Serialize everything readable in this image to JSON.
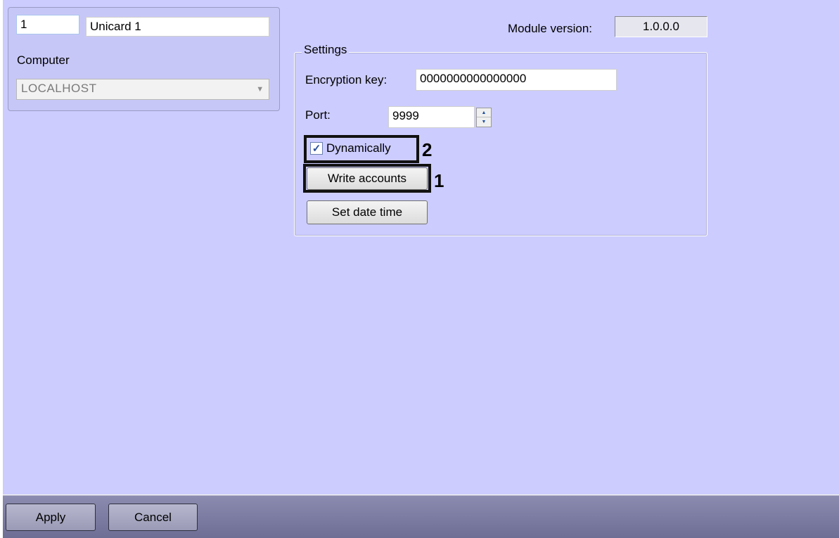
{
  "object": {
    "id_value": "1",
    "name_value": "Unicard 1",
    "computer_label": "Computer",
    "computer_value": "LOCALHOST"
  },
  "module": {
    "label": "Module version:",
    "value": "1.0.0.0"
  },
  "settings": {
    "legend": "Settings",
    "encryption_label": "Encryption key:",
    "encryption_value": "0000000000000000",
    "port_label": "Port:",
    "port_value": "9999",
    "dynamically_label": "Dynamically",
    "dynamically_checked": true,
    "write_accounts_label": "Write accounts",
    "set_date_time_label": "Set date time"
  },
  "markers": {
    "dynamically": "2",
    "write_accounts": "1"
  },
  "footer": {
    "apply_label": "Apply",
    "cancel_label": "Cancel"
  },
  "colors": {
    "panel_background": "#ccccff",
    "footer_background": "#6e6e95",
    "highlight_frame": "#111111"
  }
}
